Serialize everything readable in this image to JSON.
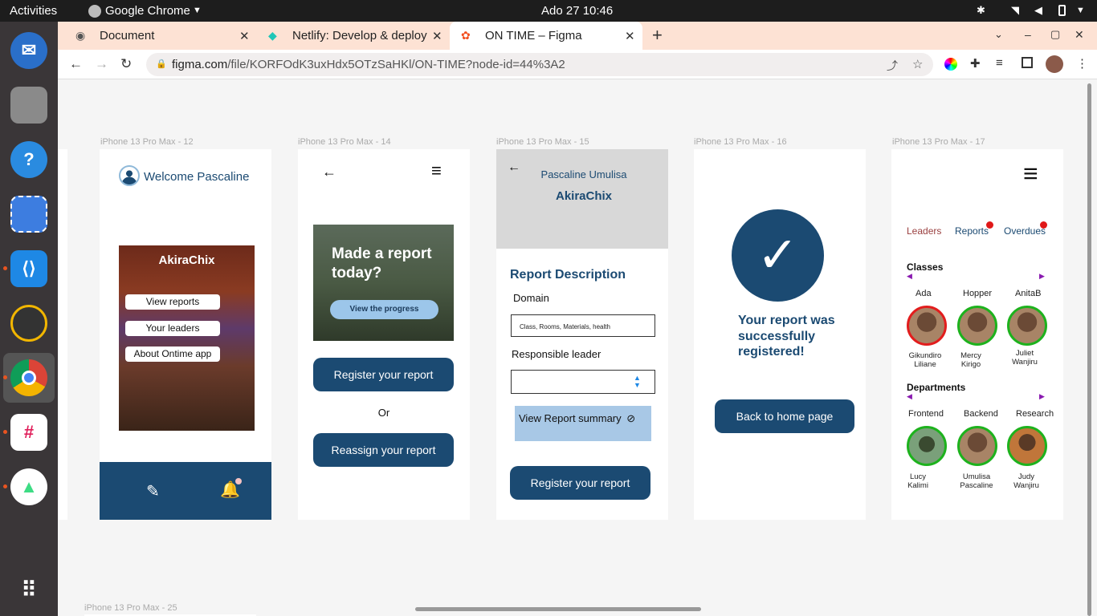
{
  "topbar": {
    "activities": "Activities",
    "app_name": "Google Chrome",
    "clock": "Ado 27  10:46"
  },
  "dock": {
    "apps": [
      "thunderbird-icon",
      "files-icon",
      "help-icon",
      "screenshot-icon",
      "vscode-icon",
      "rhythmbox-icon",
      "chrome-icon",
      "slack-icon",
      "android-studio-icon",
      "app-grid-icon"
    ]
  },
  "tabs": [
    {
      "title": "Document",
      "icon": "globe-icon"
    },
    {
      "title": "Netlify: Develop & deploy",
      "icon": "netlify-icon"
    },
    {
      "title": "ON TIME – Figma",
      "icon": "figma-icon"
    }
  ],
  "url": {
    "host": "figma.com",
    "path": "/file/KORFOdK3uxHdx5OTzSaHKl/ON-TIME?node-id=44%3A2"
  },
  "frames": {
    "f12": {
      "label": "iPhone 13 Pro Max - 12",
      "welcome": "Welcome Pascaline",
      "org": "AkiraChix",
      "menu": [
        "View reports",
        "Your leaders",
        "About Ontime app"
      ]
    },
    "f14": {
      "label": "iPhone 13 Pro Max - 14",
      "headline": "Made a report today?",
      "progress_btn": "View the progress",
      "register_btn": "Register your report",
      "or": "Or",
      "reassign_btn": "Reassign your report"
    },
    "f15": {
      "label": "iPhone 13 Pro Max - 15",
      "user": "Pascaline Umulisa",
      "org": "AkiraChix",
      "section": "Report Description",
      "domain_label": "Domain",
      "domain_value": "Class, Rooms, Materials, health",
      "leader_label": "Responsible leader",
      "summary_btn": "View Report summary",
      "register_btn": "Register your report"
    },
    "f16": {
      "label": "iPhone 13 Pro Max - 16",
      "message": "Your report was successfully registered!",
      "home_btn": "Back to home page"
    },
    "f17": {
      "label": "iPhone 13 Pro Max - 17",
      "tabs": [
        "Leaders",
        "Reports",
        "Overdues"
      ],
      "classes_title": "Classes",
      "classes": [
        "Ada",
        "Hopper",
        "AnitaB"
      ],
      "class_people": [
        "Gikundiro Liliane",
        "Mercy Kirigo",
        "Juliet Wanjiru"
      ],
      "departments_title": "Departments",
      "departments": [
        "Frontend",
        "Backend",
        "Research"
      ],
      "dept_people": [
        "Lucy Kalimi",
        "Umulisa Pascaline",
        "Judy Wanjiru"
      ]
    },
    "f25": {
      "label": "iPhone 13 Pro Max - 25"
    }
  },
  "colors": {
    "navy": "#1b4a72",
    "dock": "#3a3638",
    "tabbar": "#fde2d4",
    "green_ring": "#1db21d",
    "red_ring": "#e21d1d"
  }
}
